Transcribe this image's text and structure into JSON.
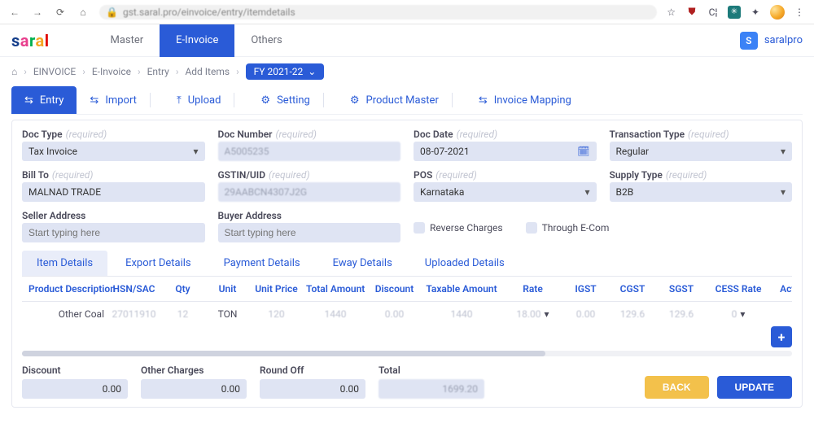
{
  "browser": {
    "url": "gst.saral.pro/einvoice/entry/itemdetails",
    "star": "☆"
  },
  "header": {
    "top_tabs": [
      "Master",
      "E-Invoice",
      "Others"
    ],
    "active_tab": 1,
    "user_badge": "S",
    "user_name": "saralpro"
  },
  "breadcrumb": {
    "home": "⌂",
    "items": [
      "EINVOICE",
      "E-Invoice",
      "Entry",
      "Add Items"
    ],
    "fy_label": "FY 2021-22"
  },
  "action_tabs": [
    {
      "icon": "swap",
      "label": "Entry",
      "active": true
    },
    {
      "icon": "swap",
      "label": "Import"
    },
    {
      "icon": "upload",
      "label": "Upload"
    },
    {
      "icon": "gear",
      "label": "Setting"
    },
    {
      "icon": "gear",
      "label": "Product Master"
    },
    {
      "icon": "swap",
      "label": "Invoice Mapping"
    }
  ],
  "form": {
    "doc_type": {
      "label": "Doc Type",
      "hint": "(required)",
      "value": "Tax Invoice"
    },
    "doc_number": {
      "label": "Doc Number",
      "hint": "(required)",
      "value": "A5005235"
    },
    "doc_date": {
      "label": "Doc Date",
      "hint": "(required)",
      "value": "08-07-2021"
    },
    "transaction_type": {
      "label": "Transaction Type",
      "hint": "(required)",
      "value": "Regular"
    },
    "bill_to": {
      "label": "Bill To",
      "hint": "(required)",
      "value": "MALNAD TRADE"
    },
    "gstin": {
      "label": "GSTIN/UID",
      "hint": "(required)",
      "value": "29AABCN4307J2G"
    },
    "pos": {
      "label": "POS",
      "hint": "(required)",
      "value": "Karnataka"
    },
    "supply_type": {
      "label": "Supply Type",
      "hint": "(required)",
      "value": "B2B"
    },
    "seller_addr": {
      "label": "Seller Address",
      "placeholder": "Start typing here"
    },
    "buyer_addr": {
      "label": "Buyer Address",
      "placeholder": "Start typing here"
    },
    "reverse_charges": "Reverse Charges",
    "through_ecom": "Through E-Com"
  },
  "inner_tabs": [
    "Item Details",
    "Export Details",
    "Payment Details",
    "Eway Details",
    "Uploaded Details"
  ],
  "inner_active": 0,
  "table": {
    "headers": [
      "Product Description",
      "HSN/SAC",
      "Qty",
      "Unit",
      "Unit Price",
      "Total Amount",
      "Discount",
      "Taxable Amount",
      "Rate",
      "IGST",
      "CGST",
      "SGST",
      "CESS Rate",
      "Action"
    ],
    "row": {
      "product": "Other Coal",
      "hsn": "27011910",
      "qty": "12",
      "unit": "TON",
      "unit_price": "120",
      "total_amount": "1440",
      "discount": "0.00",
      "taxable": "1440",
      "rate": "18.00",
      "igst": "0.00",
      "cgst": "129.6",
      "sgst": "129.6",
      "cess": "0"
    }
  },
  "totals": {
    "discount": {
      "label": "Discount",
      "value": "0.00"
    },
    "other_charges": {
      "label": "Other Charges",
      "value": "0.00"
    },
    "round_off": {
      "label": "Round Off",
      "value": "0.00"
    },
    "total": {
      "label": "Total",
      "value": "1699.20"
    }
  },
  "buttons": {
    "back": "BACK",
    "update": "UPDATE"
  }
}
